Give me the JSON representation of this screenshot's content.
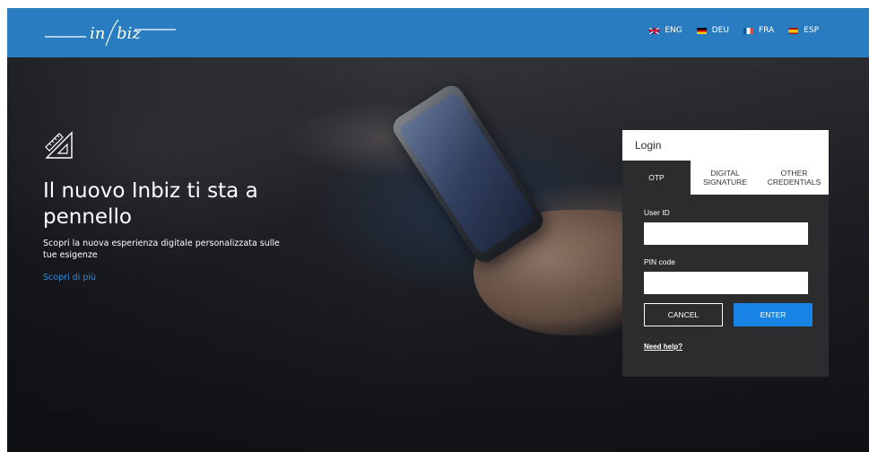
{
  "header": {
    "logo_text": "in biz",
    "languages": [
      {
        "code": "ENG",
        "flag": "uk-flag-icon"
      },
      {
        "code": "DEU",
        "flag": "germany-flag-icon"
      },
      {
        "code": "FRA",
        "flag": "france-flag-icon"
      },
      {
        "code": "ESP",
        "flag": "spain-flag-icon"
      }
    ],
    "bg_color": "#2a7cc1"
  },
  "hero": {
    "icon": "ruler-set-square-icon",
    "headline": "Il nuovo Inbiz ti sta a pennello",
    "subtext": "Scopri la nuova esperienza digitale personalizzata sulle tue esigenze",
    "link": "Scopri di più"
  },
  "login": {
    "title": "Login",
    "tabs": [
      {
        "label": "OTP",
        "active": true
      },
      {
        "label": "DIGITAL SIGNATURE",
        "active": false
      },
      {
        "label": "OTHER CREDENTIALS",
        "active": false
      }
    ],
    "user_id_label": "User ID",
    "user_id_value": "",
    "pin_label": "PIN code",
    "pin_value": "",
    "cancel_label": "CANCEL",
    "enter_label": "ENTER",
    "help_link": "Need help?",
    "accent_color": "#1784e6"
  }
}
